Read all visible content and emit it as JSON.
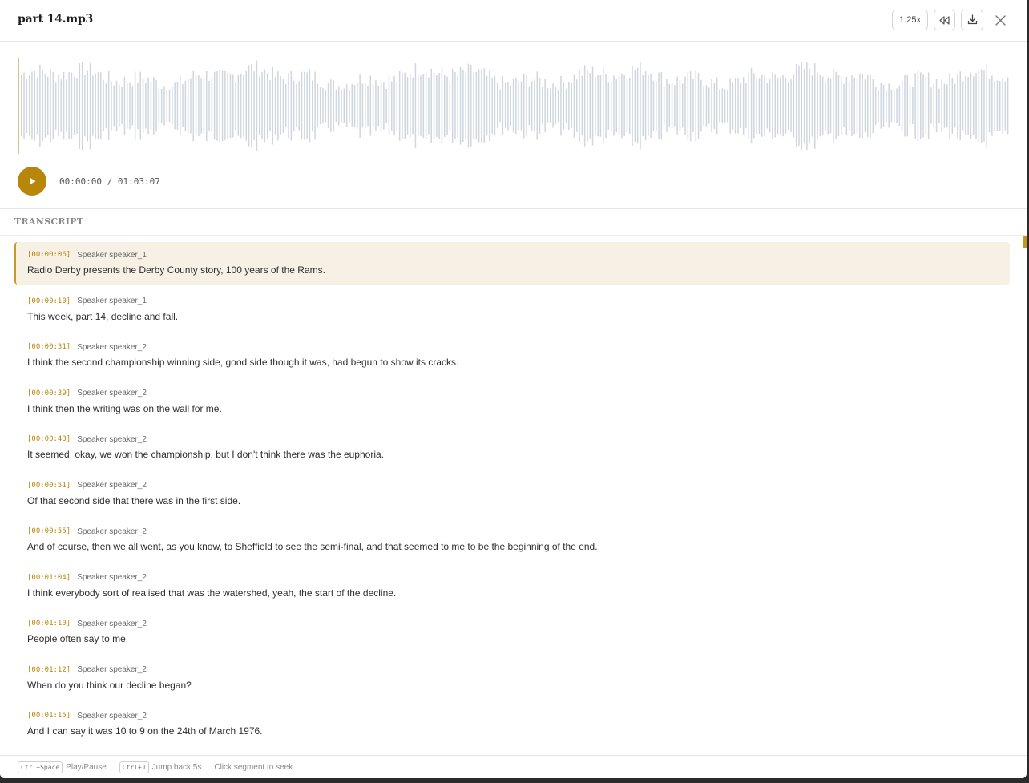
{
  "file": {
    "title": "part 14.mp3"
  },
  "toolbar": {
    "speed_label": "1.25x",
    "rewind_icon": "rewind-icon",
    "download_icon": "download-icon",
    "close_icon": "close-icon"
  },
  "player": {
    "time_readout": "00:00:00 / 01:03:07",
    "progress": 0,
    "play_icon": "play-icon"
  },
  "transcript": {
    "label": "TRANSCRIPT",
    "segments": [
      {
        "time": "[00:00:06]",
        "speaker": "Speaker speaker_1",
        "text": "Radio Derby presents the Derby County story, 100 years of the Rams."
      },
      {
        "time": "[00:00:10]",
        "speaker": "Speaker speaker_1",
        "text": "This week, part 14, decline and fall."
      },
      {
        "time": "[00:00:31]",
        "speaker": "Speaker speaker_2",
        "text": "I think the second championship winning side, good side though it was, had begun to show its cracks."
      },
      {
        "time": "[00:00:39]",
        "speaker": "Speaker speaker_2",
        "text": "I think then the writing was on the wall for me."
      },
      {
        "time": "[00:00:43]",
        "speaker": "Speaker speaker_2",
        "text": "It seemed, okay, we won the championship, but I don't think there was the euphoria."
      },
      {
        "time": "[00:00:51]",
        "speaker": "Speaker speaker_2",
        "text": "Of that second side that there was in the first side."
      },
      {
        "time": "[00:00:55]",
        "speaker": "Speaker speaker_2",
        "text": "And of course, then we all went, as you know, to Sheffield to see the semi-final, and that seemed to me to be the beginning of the end."
      },
      {
        "time": "[00:01:04]",
        "speaker": "Speaker speaker_2",
        "text": "I think everybody sort of realised that was the watershed, yeah, the start of the decline."
      },
      {
        "time": "[00:01:10]",
        "speaker": "Speaker speaker_2",
        "text": "People often say to me,"
      },
      {
        "time": "[00:01:12]",
        "speaker": "Speaker speaker_2",
        "text": "When do you think our decline began?"
      },
      {
        "time": "[00:01:15]",
        "speaker": "Speaker speaker_2",
        "text": "And I can say it was 10 to 9 on the 24th of March 1976."
      }
    ]
  },
  "footer": {
    "play_key": "Ctrl+Space",
    "play_label": "Play/Pause",
    "jump_key": "Ctrl+J",
    "jump_label": "Jump back 5s",
    "seek_hint": "Click segment to seek"
  },
  "colors": {
    "accent": "#b8860b",
    "waveform": "#cfd6de",
    "active_segment_bg": "#f6f1e4"
  }
}
